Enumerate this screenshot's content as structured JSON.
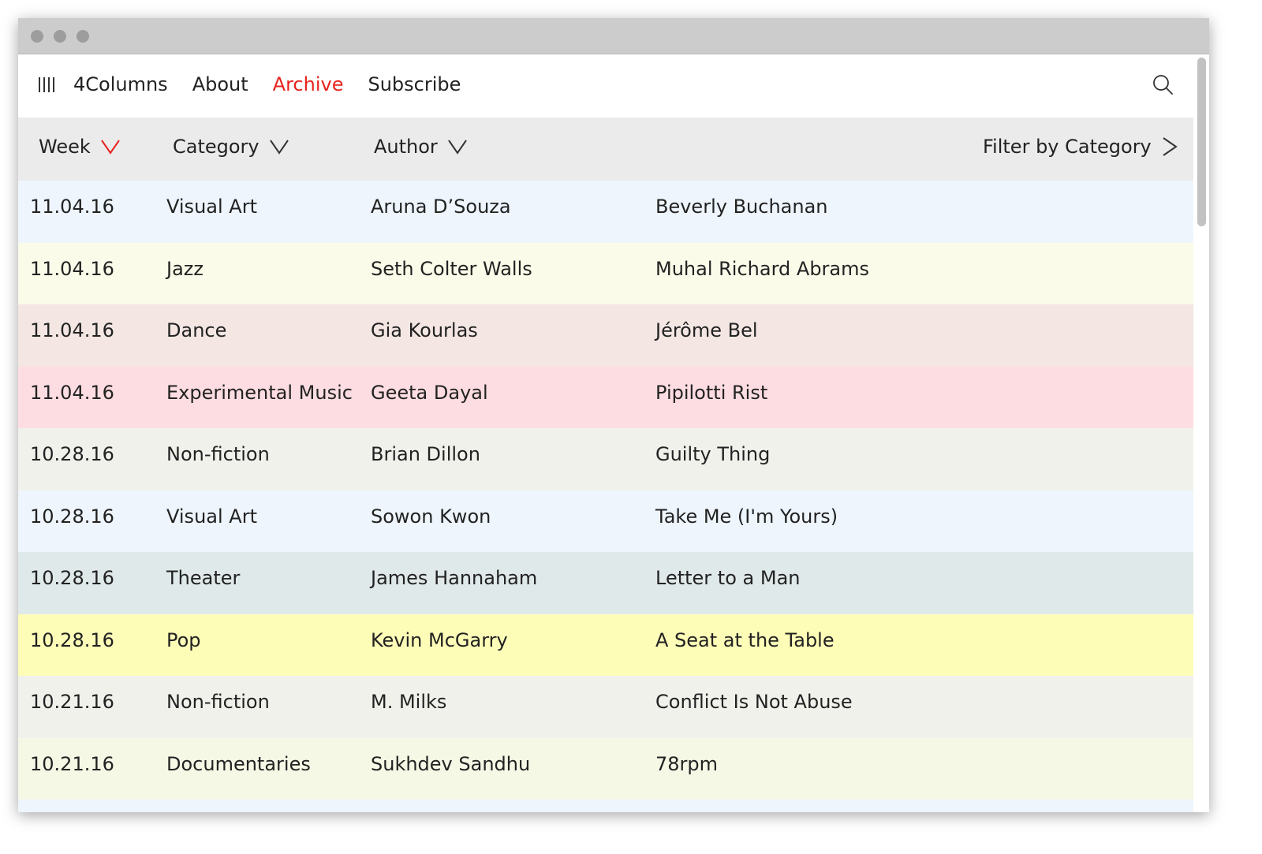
{
  "window": {
    "controls": [
      "close",
      "minimize",
      "maximize"
    ]
  },
  "nav": {
    "logo_icon": "four-columns-logo-icon",
    "items": [
      {
        "label": "4Columns",
        "active": false
      },
      {
        "label": "About",
        "active": false
      },
      {
        "label": "Archive",
        "active": true
      },
      {
        "label": "Subscribe",
        "active": false
      }
    ],
    "search_icon": "search-icon",
    "active_color": "#e8231d"
  },
  "table": {
    "headers": {
      "week": "Week",
      "category": "Category",
      "author": "Author",
      "filter": "Filter by Category"
    },
    "sort_active": "week",
    "rows": [
      {
        "week": "11.04.16",
        "category": "Visual Art",
        "author": "Aruna D’Souza",
        "title": "Beverly Buchanan",
        "color": "#eef5fd"
      },
      {
        "week": "11.04.16",
        "category": "Jazz",
        "author": "Seth Colter Walls",
        "title": "Muhal Richard Abrams",
        "color": "#fbfbea"
      },
      {
        "week": "11.04.16",
        "category": "Dance",
        "author": "Gia Kourlas",
        "title": "Jérôme Bel",
        "color": "#f3e6e3"
      },
      {
        "week": "11.04.16",
        "category": "Experimental Music",
        "author": "Geeta Dayal",
        "title": "Pipilotti Rist",
        "color": "#fddde2"
      },
      {
        "week": "10.28.16",
        "category": "Non-fiction",
        "author": "Brian Dillon",
        "title": "Guilty Thing",
        "color": "#f1f1ec"
      },
      {
        "week": "10.28.16",
        "category": "Visual Art",
        "author": "Sowon Kwon",
        "title": "Take Me (I'm Yours)",
        "color": "#eef5fd"
      },
      {
        "week": "10.28.16",
        "category": "Theater",
        "author": "James Hannaham",
        "title": "Letter to a Man",
        "color": "#e0e9ea"
      },
      {
        "week": "10.28.16",
        "category": "Pop",
        "author": "Kevin McGarry",
        "title": "A Seat at the Table",
        "color": "#fefdb8"
      },
      {
        "week": "10.21.16",
        "category": "Non-fiction",
        "author": "M. Milks",
        "title": "Conflict Is Not Abuse",
        "color": "#f1f1ec"
      },
      {
        "week": "10.21.16",
        "category": "Documentaries",
        "author": "Sukhdev Sandhu",
        "title": "78rpm",
        "color": "#f4f8e4"
      },
      {
        "week": "",
        "category": "",
        "author": "",
        "title": "",
        "color": "#eef5fd"
      }
    ]
  }
}
